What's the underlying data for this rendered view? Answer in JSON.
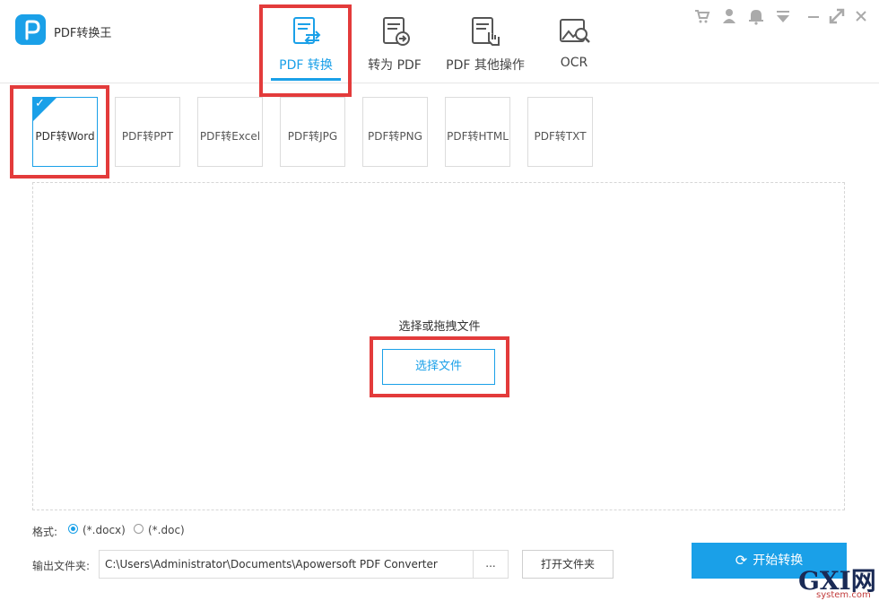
{
  "app": {
    "title": "PDF转换王"
  },
  "nav": {
    "tabs": [
      {
        "label": "PDF 转换",
        "icon": "pdf-convert-icon"
      },
      {
        "label": "转为 PDF",
        "icon": "to-pdf-icon"
      },
      {
        "label": "PDF 其他操作",
        "icon": "pdf-other-icon"
      },
      {
        "label": "OCR",
        "icon": "ocr-icon"
      }
    ],
    "active_index": 0
  },
  "window_icons": [
    "cart-icon",
    "user-icon",
    "bell-icon",
    "dropdown-icon",
    "minimize-icon",
    "maximize-icon",
    "close-icon"
  ],
  "sub_tabs": [
    "PDF转Word",
    "PDF转PPT",
    "PDF转Excel",
    "PDF转JPG",
    "PDF转PNG",
    "PDF转HTML",
    "PDF转TXT"
  ],
  "dropzone": {
    "hint": "选择或拖拽文件",
    "select_button": "选择文件"
  },
  "format": {
    "label": "格式:",
    "options": [
      "(*.docx)",
      "(*.doc)"
    ],
    "selected_index": 0
  },
  "output": {
    "label": "输出文件夹:",
    "path": "C:\\Users\\Administrator\\Documents\\Apowersoft PDF Converter",
    "browse_label": "...",
    "open_folder_label": "打开文件夹"
  },
  "start_button": "开始转换",
  "watermark": {
    "main": "GXI网",
    "sub": "system.com"
  },
  "colors": {
    "accent": "#1aa0e8",
    "highlight": "#e33b3b"
  }
}
